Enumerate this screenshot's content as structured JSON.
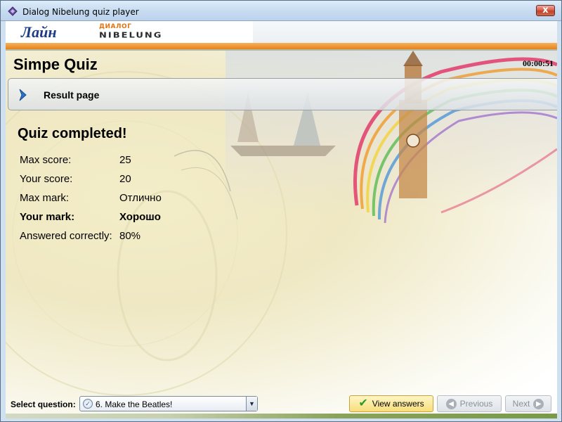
{
  "window": {
    "title": "Dialog Nibelung quiz player",
    "close_label": "x"
  },
  "header": {
    "logo_layn": "Лайн",
    "logo_dialog_small": "ДИАЛОГ",
    "logo_nibelung": "NIBELUNG"
  },
  "quiz": {
    "title": "Simpe Quiz",
    "timer": "00:00:51"
  },
  "page_bar": {
    "label": "Result page"
  },
  "result": {
    "heading": "Quiz completed!",
    "rows": [
      {
        "label": "Max score:",
        "value": "25",
        "bold": false
      },
      {
        "label": "Your score:",
        "value": "20",
        "bold": false
      },
      {
        "label": "Max mark:",
        "value": "Отлично",
        "bold": false
      },
      {
        "label": "Your mark:",
        "value": "Хорошо",
        "bold": true
      },
      {
        "label": "Answered correctly:",
        "value": "80%",
        "bold": false
      }
    ]
  },
  "footer": {
    "select_label": "Select question:",
    "selected_question": "6. Make the Beatles!",
    "view_answers_label": "View answers",
    "previous_label": "Previous",
    "next_label": "Next"
  },
  "colors": {
    "accent_orange": "#e5821a",
    "logo_blue": "#1d3c87",
    "check_green": "#2f9a24"
  }
}
